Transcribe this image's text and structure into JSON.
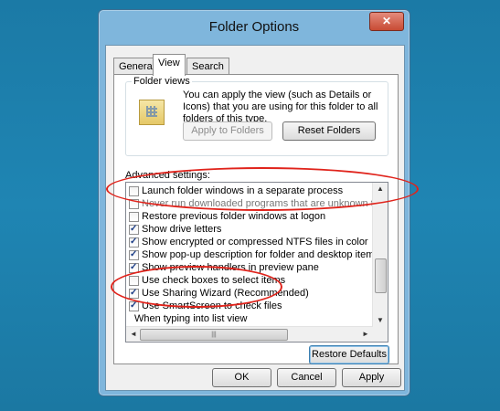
{
  "window": {
    "title": "Folder Options",
    "close_glyph": "✕"
  },
  "tabs": [
    {
      "label": "General",
      "active": false
    },
    {
      "label": "View",
      "active": true
    },
    {
      "label": "Search",
      "active": false
    }
  ],
  "folder_views": {
    "legend": "Folder views",
    "description": "You can apply the view (such as Details or Icons) that you are using for this folder to all folders of this type.",
    "apply_button": "Apply to Folders",
    "reset_button": "Reset Folders"
  },
  "advanced": {
    "label": "Advanced settings:",
    "items": [
      {
        "label": "Launch folder windows in a separate process",
        "checked": false
      },
      {
        "label": "Never run downloaded programs that are unknown to SmartScreen",
        "checked": false
      },
      {
        "label": "Restore previous folder windows at logon",
        "checked": false
      },
      {
        "label": "Show drive letters",
        "checked": true
      },
      {
        "label": "Show encrypted or compressed NTFS files in color",
        "checked": true
      },
      {
        "label": "Show pop-up description for folder and desktop items",
        "checked": true
      },
      {
        "label": "Show preview handlers in preview pane",
        "checked": true
      },
      {
        "label": "Use check boxes to select items",
        "checked": false
      },
      {
        "label": "Use Sharing Wizard (Recommended)",
        "checked": true
      },
      {
        "label": "Use SmartScreen to check files",
        "checked": true
      },
      {
        "label": "When typing into list view",
        "checked": false
      }
    ],
    "scroll_up": "▲",
    "scroll_down": "▼",
    "scroll_left": "◄",
    "scroll_right": "►",
    "hthumb_grip": "|||"
  },
  "restore_defaults_button": "Restore Defaults",
  "footer": {
    "ok": "OK",
    "cancel": "Cancel",
    "apply": "Apply"
  },
  "colors": {
    "highlight_ellipse": "#e0231b",
    "desktop": "#1e7ba3"
  }
}
